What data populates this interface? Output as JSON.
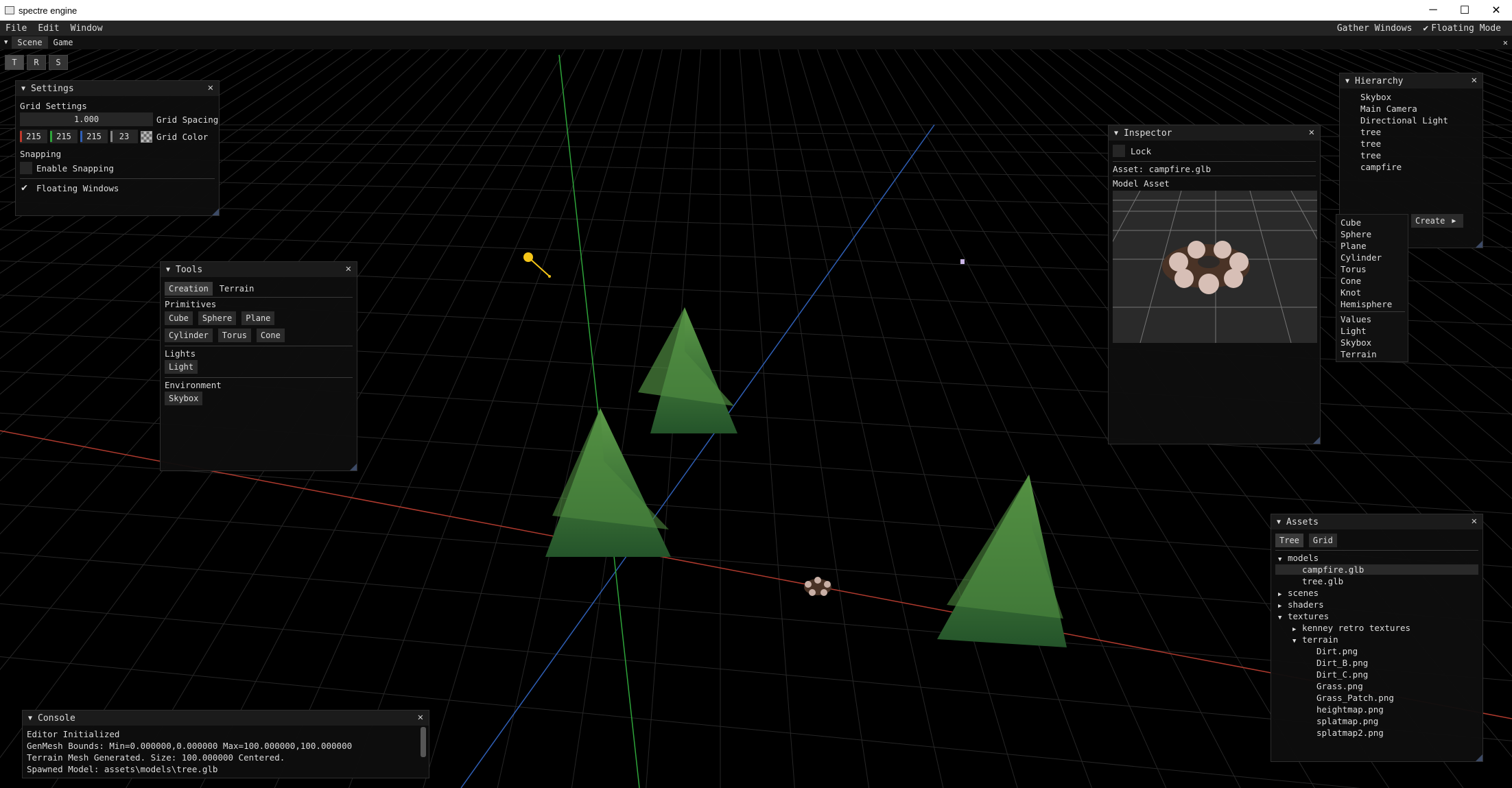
{
  "window": {
    "title": "spectre engine",
    "minimize": "─",
    "maximize": "☐",
    "close": "✕"
  },
  "menubar": {
    "items": [
      "File",
      "Edit",
      "Window"
    ],
    "gather_windows": "Gather Windows",
    "floating_mode": "Floating Mode"
  },
  "tabs": [
    "Scene",
    "Game"
  ],
  "gizmo": [
    "T",
    "R",
    "S"
  ],
  "settings": {
    "title": "Settings",
    "grid_settings": "Grid Settings",
    "grid_spacing_value": "1.000",
    "grid_spacing_label": "Grid Spacing",
    "grid_color": {
      "r": "215",
      "g": "215",
      "b": "215",
      "a": "23"
    },
    "grid_color_label": "Grid Color",
    "snapping": "Snapping",
    "enable_snapping": "Enable Snapping",
    "enable_snapping_checked": false,
    "floating_windows": "Floating Windows",
    "floating_windows_checked": true
  },
  "tools": {
    "title": "Tools",
    "tabs": [
      "Creation",
      "Terrain"
    ],
    "primitives_label": "Primitives",
    "primitives_row1": [
      "Cube",
      "Sphere",
      "Plane"
    ],
    "primitives_row2": [
      "Cylinder",
      "Torus",
      "Cone"
    ],
    "lights_label": "Lights",
    "light_button": "Light",
    "environment_label": "Environment",
    "skybox_button": "Skybox"
  },
  "inspector": {
    "title": "Inspector",
    "lock": "Lock",
    "asset": "Asset: campfire.glb",
    "model_asset": "Model Asset"
  },
  "hierarchy": {
    "title": "Hierarchy",
    "items": [
      "Skybox",
      "Main Camera",
      "Directional Light",
      "tree",
      "tree",
      "tree",
      "campfire"
    ],
    "create_button": "Create"
  },
  "create_menu": {
    "items": [
      "Cube",
      "Sphere",
      "Plane",
      "Cylinder",
      "Torus",
      "Cone",
      "Knot",
      "Hemisphere",
      "Values",
      "Light",
      "Skybox",
      "Terrain"
    ]
  },
  "assets": {
    "title": "Assets",
    "tabs": [
      "Tree",
      "Grid"
    ],
    "tree": [
      {
        "label": "models",
        "depth": 0,
        "arrow": "open"
      },
      {
        "label": "campfire.glb",
        "depth": 1,
        "arrow": "none",
        "selected": true
      },
      {
        "label": "tree.glb",
        "depth": 1,
        "arrow": "none"
      },
      {
        "label": "scenes",
        "depth": 0,
        "arrow": "closed"
      },
      {
        "label": "shaders",
        "depth": 0,
        "arrow": "closed"
      },
      {
        "label": "textures",
        "depth": 0,
        "arrow": "open"
      },
      {
        "label": "kenney retro textures",
        "depth": 1,
        "arrow": "closed"
      },
      {
        "label": "terrain",
        "depth": 1,
        "arrow": "open"
      },
      {
        "label": "Dirt.png",
        "depth": 2,
        "arrow": "none"
      },
      {
        "label": "Dirt_B.png",
        "depth": 2,
        "arrow": "none"
      },
      {
        "label": "Dirt_C.png",
        "depth": 2,
        "arrow": "none"
      },
      {
        "label": "Grass.png",
        "depth": 2,
        "arrow": "none"
      },
      {
        "label": "Grass_Patch.png",
        "depth": 2,
        "arrow": "none"
      },
      {
        "label": "heightmap.png",
        "depth": 2,
        "arrow": "none"
      },
      {
        "label": "splatmap.png",
        "depth": 2,
        "arrow": "none"
      },
      {
        "label": "splatmap2.png",
        "depth": 2,
        "arrow": "none"
      }
    ]
  },
  "console": {
    "title": "Console",
    "lines": [
      "Editor Initialized",
      "GenMesh Bounds: Min=0.000000,0.000000 Max=100.000000,100.000000",
      "Terrain Mesh Generated. Size: 100.000000 Centered.",
      "Spawned Model: assets\\models\\tree.glb"
    ]
  },
  "colors": {
    "background": "#000000",
    "panel": "#0e0e0e",
    "axis_x": "#c0392b",
    "axis_y": "#2ecc40",
    "axis_z": "#2f6fd6",
    "light_gizmo": "#f5c518",
    "tree": "#3f7a3a"
  }
}
